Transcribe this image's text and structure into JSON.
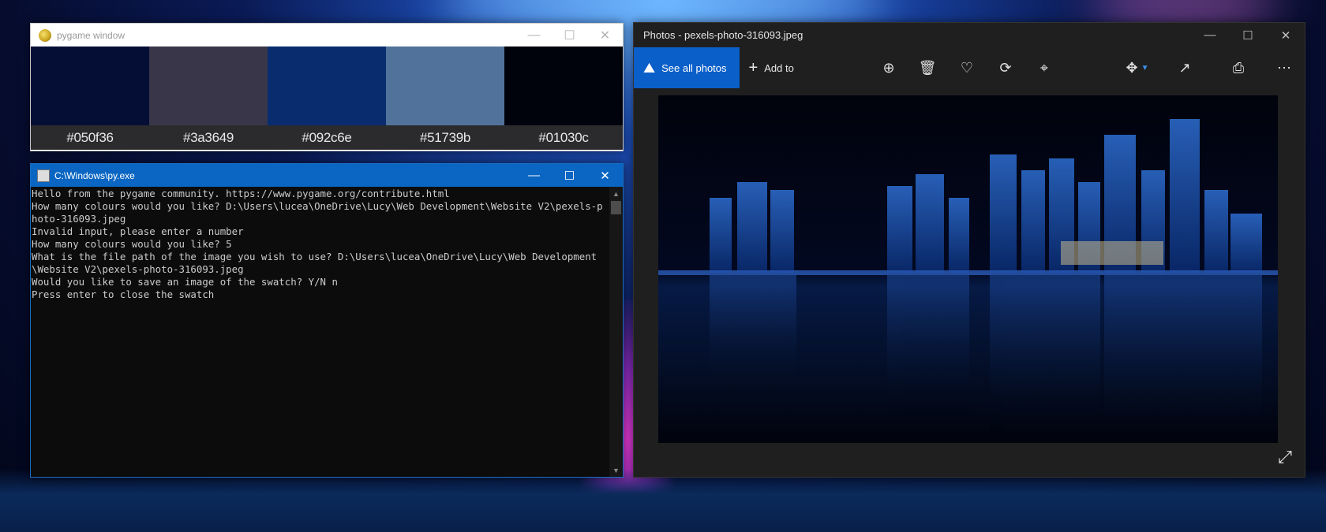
{
  "pygame_window": {
    "title": "pygame window",
    "swatches": [
      {
        "hex": "#050f36",
        "label": "#050f36"
      },
      {
        "hex": "#3a3649",
        "label": "#3a3649"
      },
      {
        "hex": "#092c6e",
        "label": "#092c6e"
      },
      {
        "hex": "#51739b",
        "label": "#51739b"
      },
      {
        "hex": "#01030c",
        "label": "#01030c"
      }
    ]
  },
  "console_window": {
    "title": "C:\\Windows\\py.exe",
    "output": "Hello from the pygame community. https://www.pygame.org/contribute.html\nHow many colours would you like? D:\\Users\\lucea\\OneDrive\\Lucy\\Web Development\\Website V2\\pexels-photo-316093.jpeg\nInvalid input, please enter a number\nHow many colours would you like? 5\nWhat is the file path of the image you wish to use? D:\\Users\\lucea\\OneDrive\\Lucy\\Web Development\\Website V2\\pexels-photo-316093.jpeg\nWould you like to save an image of the swatch? Y/N n\nPress enter to close the swatch"
  },
  "photos_window": {
    "title": "Photos - pexels-photo-316093.jpeg",
    "see_all_label": "See all photos",
    "add_to_label": "Add to"
  },
  "icons": {
    "minimize": "minimize-icon",
    "maximize": "maximize-icon",
    "close": "close-icon",
    "zoom": "zoom-in-icon",
    "delete": "delete-icon",
    "favorite": "heart-icon",
    "rotate": "rotate-icon",
    "crop": "crop-icon",
    "edit": "edit-create-icon",
    "share": "share-icon",
    "print": "print-icon",
    "more": "more-icon",
    "fullscreen": "expand-icon"
  },
  "colors": {
    "console_titlebar": "#0a66c2",
    "photos_accent": "#0a5fc8"
  }
}
